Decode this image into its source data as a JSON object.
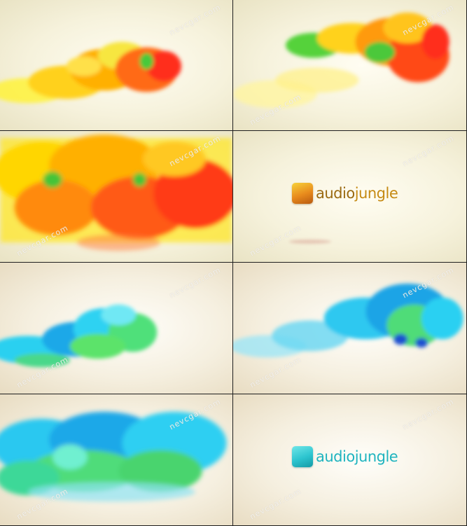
{
  "watermark": "nevcgar.com",
  "panels": [
    {
      "id": "warm-smoke-1",
      "palette": "warm"
    },
    {
      "id": "warm-smoke-2",
      "palette": "warm"
    },
    {
      "id": "warm-smoke-3",
      "palette": "warm"
    },
    {
      "id": "warm-logo",
      "palette": "warm",
      "logo": {
        "part1": "audio",
        "part2": "jungle"
      }
    },
    {
      "id": "cool-smoke-1",
      "palette": "cool"
    },
    {
      "id": "cool-smoke-2",
      "palette": "cool"
    },
    {
      "id": "cool-smoke-3",
      "palette": "cool"
    },
    {
      "id": "cool-logo",
      "palette": "cool",
      "logo": {
        "text": "audiojungle"
      }
    }
  ],
  "colors": {
    "warm": [
      "#ffe91a",
      "#ffb300",
      "#ff6a1a",
      "#ff2f1a",
      "#4fd13a"
    ],
    "cool": [
      "#2fd0f2",
      "#1aa7e6",
      "#4fe07a",
      "#6ef0d0",
      "#1b5bd6"
    ]
  }
}
